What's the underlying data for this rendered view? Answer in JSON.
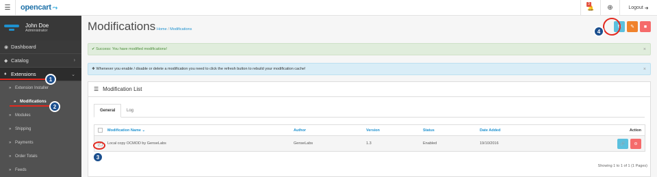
{
  "topbar": {
    "logo": "opencart",
    "logo_cart": "→└┘",
    "notification_count": "3",
    "logout_label": "Logout"
  },
  "sidebar": {
    "user_name": "John Doe",
    "user_role": "Administrator",
    "items": [
      {
        "label": "Dashboard",
        "icon": "dashboard-icon"
      },
      {
        "label": "Catalog",
        "icon": "tag-icon"
      },
      {
        "label": "Extensions",
        "icon": "puzzle-icon"
      }
    ],
    "subitems": [
      {
        "label": "Extension Installer"
      },
      {
        "label": "Modifications"
      },
      {
        "label": "Modules"
      },
      {
        "label": "Shipping"
      },
      {
        "label": "Payments"
      },
      {
        "label": "Order Totals"
      },
      {
        "label": "Feeds"
      }
    ]
  },
  "header": {
    "title": "Modifications",
    "breadcrumb_home": "Home",
    "breadcrumb_sep": "/",
    "breadcrumb_current": "Modifications"
  },
  "alerts": {
    "success": "Success: You have modified modifications!",
    "info": "Whenever you enable / disable or delete a modification you need to click the refresh button to rebuild your modification cache!"
  },
  "panel": {
    "title": "Modification List",
    "tabs": [
      "General",
      "Log"
    ]
  },
  "table": {
    "headers": {
      "name": "Modification Name",
      "author": "Author",
      "version": "Version",
      "status": "Status",
      "date_added": "Date Added",
      "action": "Action"
    },
    "rows": [
      {
        "name": "Local copy OCMOD by GenseLabs",
        "author": "GenseLabs",
        "version": "1.3",
        "status": "Enabled",
        "date_added": "19/10/2016"
      }
    ],
    "pagination": "Showing 1 to 1 of 1 (1 Pages)"
  },
  "markers": [
    "1",
    "2",
    "3",
    "4"
  ],
  "colors": {
    "accent": "#1e91cf",
    "refresh_button": "#5bc0de",
    "clear_button": "#f0822c",
    "delete_button": "#f56b6b",
    "annotation": "#e3281e"
  }
}
